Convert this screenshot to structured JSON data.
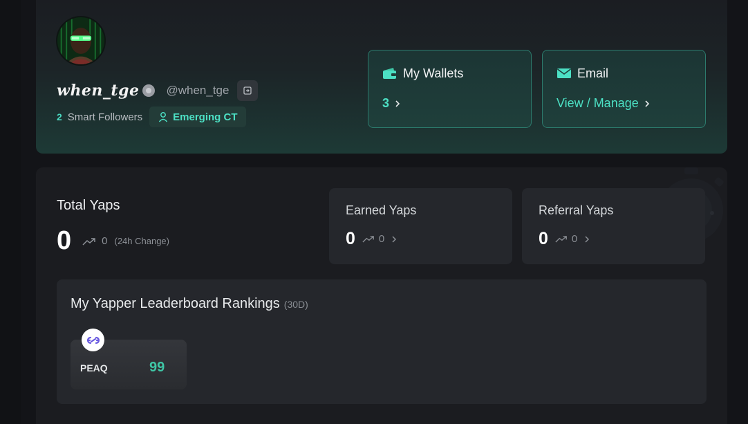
{
  "profile": {
    "display_name": "when_tge",
    "handle": "@when_tge",
    "smart_followers_count": "2",
    "smart_followers_label": "Smart Followers",
    "tag": "Emerging CT"
  },
  "wallets": {
    "title": "My Wallets",
    "count": "3",
    "icon": "wallet-icon"
  },
  "email": {
    "title": "Email",
    "link": "View / Manage",
    "icon": "envelope-icon"
  },
  "total_yaps": {
    "title": "Total Yaps",
    "value": "0",
    "change": "0",
    "change_label": "(24h Change)"
  },
  "earned_yaps": {
    "title": "Earned Yaps",
    "value": "0",
    "change": "0"
  },
  "referral_yaps": {
    "title": "Referral Yaps",
    "value": "0",
    "change": "0"
  },
  "leaderboard": {
    "title": "My Yapper Leaderboard Rankings",
    "period": "(30D)",
    "projects": [
      {
        "name": "PEAQ",
        "rank": "99"
      }
    ]
  },
  "colors": {
    "accent": "#4ce0c4",
    "rank": "#3fc6a6",
    "card_border": "#2c7a6c"
  }
}
